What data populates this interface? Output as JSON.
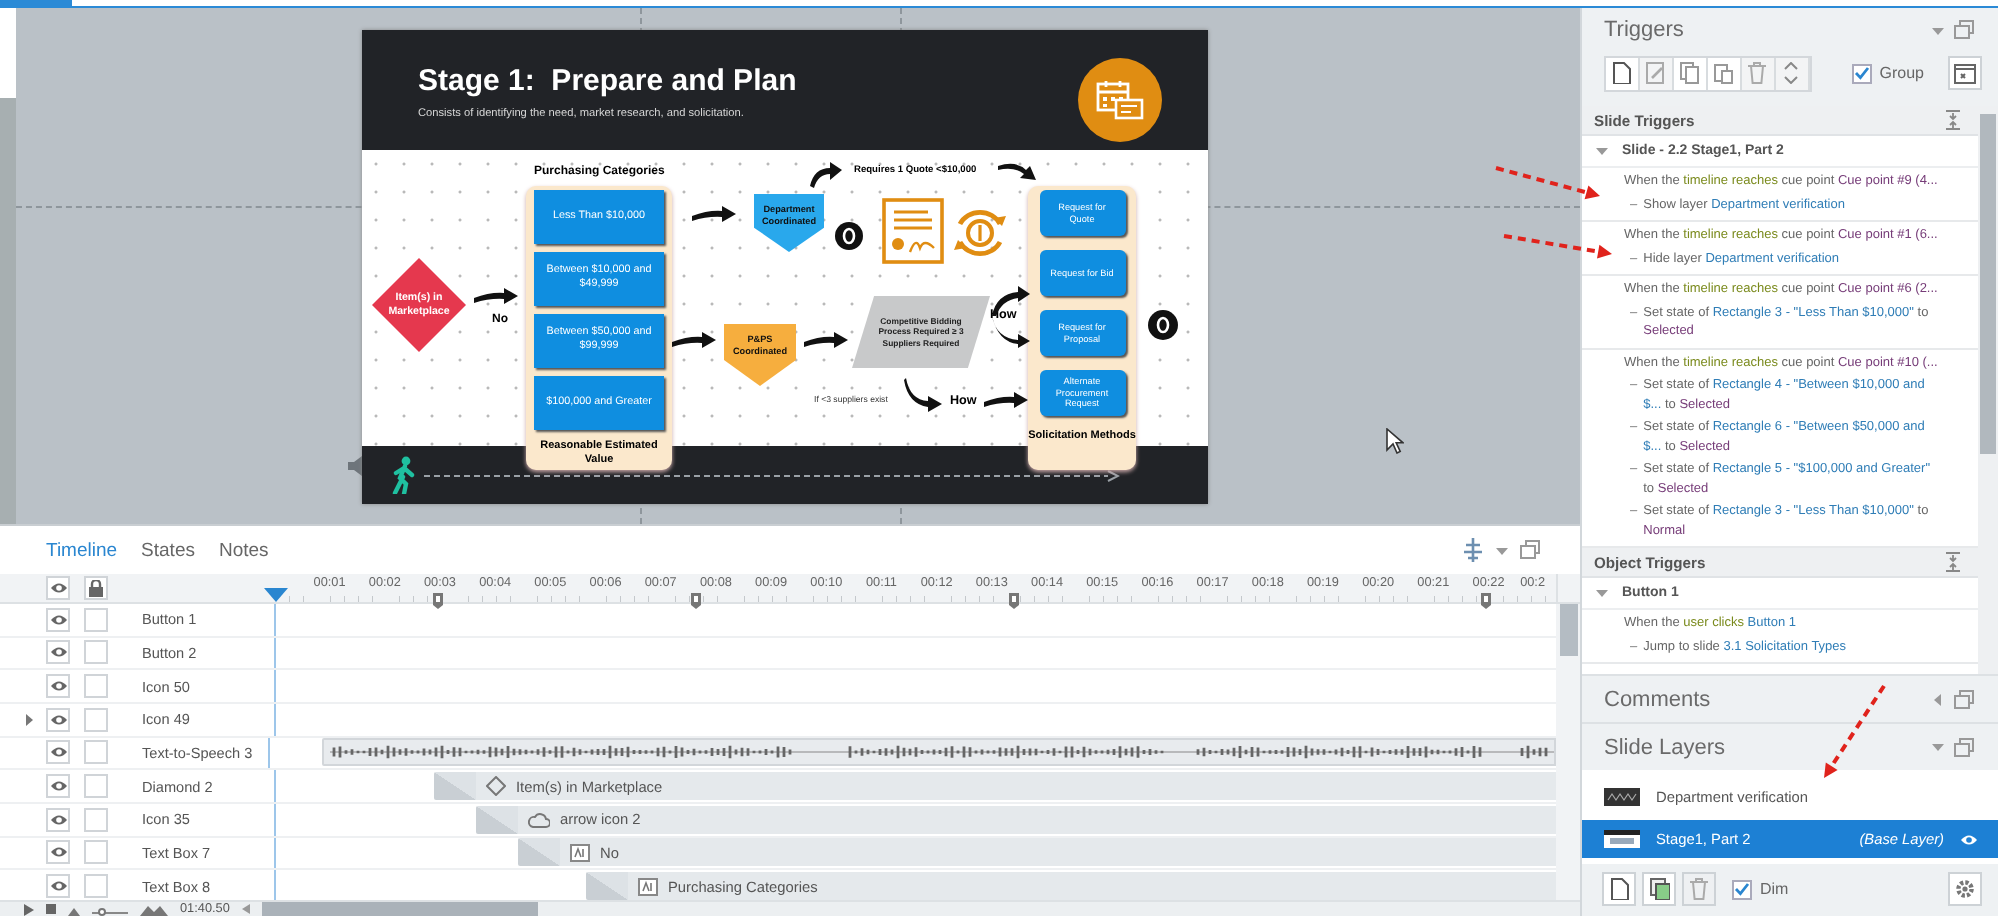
{
  "slide": {
    "title": "Stage 1:  Prepare and Plan",
    "subtitle": "Consists of identifying the need, market research, and solicitation.",
    "category_heading": "Purchasing Categories",
    "categories": [
      "Less Than $10,000",
      "Between $10,000 and $49,999",
      "Between $50,000 and $99,999",
      "$100,000 and Greater"
    ],
    "category_caption": "Reasonable Estimated Value",
    "methods": [
      "Request for Quote",
      "Request for Bid",
      "Request for Proposal",
      "Alternate Procurement Request"
    ],
    "methods_caption": "Solicitation Methods",
    "start": "Item(s) in Marketplace",
    "labels": [
      "No",
      "Requires 1 Quote <$10,000",
      "How",
      "If <3 suppliers exist",
      "How"
    ],
    "coordinators": [
      "Department Coordinated",
      "P&PS Coordinated"
    ],
    "bidding": "Competitive Bidding Process Required ≥ 3 Suppliers Required"
  },
  "timeline": {
    "tabs": [
      {
        "label": "Timeline",
        "selected": true
      },
      {
        "label": "States",
        "selected": false
      },
      {
        "label": "Notes",
        "selected": false
      }
    ],
    "ticks": [
      "00:01",
      "00:02",
      "00:03",
      "00:04",
      "00:05",
      "00:06",
      "00:07",
      "00:08",
      "00:09",
      "00:10",
      "00:11",
      "00:12",
      "00:13",
      "00:14",
      "00:15",
      "00:16",
      "00:17",
      "00:18",
      "00:19",
      "00:20",
      "00:21",
      "00:22",
      "00:2"
    ],
    "rows": [
      {
        "name": "Button 1",
        "expandable": false,
        "visible": true,
        "locked": false
      },
      {
        "name": "Button 2",
        "expandable": false,
        "visible": true,
        "locked": false
      },
      {
        "name": "Icon 50",
        "expandable": false,
        "visible": true,
        "locked": false
      },
      {
        "name": "Icon 49",
        "expandable": true,
        "visible": true,
        "locked": false
      },
      {
        "name": "Text-to-Speech 3",
        "expandable": false,
        "visible": true,
        "locked": false,
        "bar": {
          "kind": "audio"
        }
      },
      {
        "name": "Diamond 2",
        "expandable": false,
        "visible": true,
        "locked": false,
        "bar": {
          "kind": "shape",
          "label": "Item(s) in Marketplace"
        }
      },
      {
        "name": "Icon 35",
        "expandable": false,
        "visible": true,
        "locked": false,
        "bar": {
          "kind": "cloud",
          "label": "arrow icon 2"
        }
      },
      {
        "name": "Text Box 7",
        "expandable": false,
        "visible": true,
        "locked": false,
        "bar": {
          "kind": "text",
          "label": "No"
        }
      },
      {
        "name": "Text Box 8",
        "expandable": false,
        "visible": true,
        "locked": false,
        "bar": {
          "kind": "text",
          "label": "Purchasing Categories"
        }
      }
    ],
    "zoom": {
      "level": 0.2
    },
    "duration": "01:40.50"
  },
  "triggers": {
    "title": "Triggers",
    "group": {
      "label": "Group",
      "checked": true
    },
    "sections": [
      {
        "title": "Slide Triggers",
        "groups": [
          {
            "title": "Slide - 2.2 Stage1, Part 2",
            "expanded": true,
            "triggers": [
              {
                "when": [
                  {
                    "text": "When the",
                    "kind": "plain"
                  },
                  {
                    "text": "timeline reaches",
                    "kind": "event"
                  },
                  {
                    "text": "cue point",
                    "kind": "plain"
                  },
                  {
                    "text": "Cue point #9 (4...",
                    "kind": "value"
                  }
                ],
                "actions": [
                  {
                    "marker": "–",
                    "parts": [
                      {
                        "text": "Show layer",
                        "kind": "plain"
                      },
                      {
                        "text": "Department verification",
                        "kind": "object"
                      }
                    ]
                  }
                ]
              },
              {
                "when": [
                  {
                    "text": "When the",
                    "kind": "plain"
                  },
                  {
                    "text": "timeline reaches",
                    "kind": "event"
                  },
                  {
                    "text": "cue point",
                    "kind": "plain"
                  },
                  {
                    "text": "Cue point #1 (6...",
                    "kind": "value"
                  }
                ],
                "actions": [
                  {
                    "marker": "–",
                    "parts": [
                      {
                        "text": "Hide layer",
                        "kind": "plain"
                      },
                      {
                        "text": "Department verification",
                        "kind": "object"
                      }
                    ]
                  }
                ]
              },
              {
                "when": [
                  {
                    "text": "When the",
                    "kind": "plain"
                  },
                  {
                    "text": "timeline reaches",
                    "kind": "event"
                  },
                  {
                    "text": "cue point",
                    "kind": "plain"
                  },
                  {
                    "text": "Cue point #6 (2...",
                    "kind": "value"
                  }
                ],
                "actions": [
                  {
                    "marker": "–",
                    "parts": [
                      {
                        "text": "Set state of",
                        "kind": "plain"
                      },
                      {
                        "text": "Rectangle 3 - \"Less Than $10,000\"",
                        "kind": "object"
                      },
                      {
                        "text": "to",
                        "kind": "plain"
                      },
                      {
                        "text": "Selected",
                        "kind": "value"
                      }
                    ]
                  }
                ]
              },
              {
                "when": [
                  {
                    "text": "When the",
                    "kind": "plain"
                  },
                  {
                    "text": "timeline reaches",
                    "kind": "event"
                  },
                  {
                    "text": "cue point",
                    "kind": "plain"
                  },
                  {
                    "text": "Cue point #10 (...",
                    "kind": "value"
                  }
                ],
                "actions": [
                  {
                    "marker": "–",
                    "parts": [
                      {
                        "text": "Set state of",
                        "kind": "plain"
                      },
                      {
                        "text": "Rectangle 4 - \"Between $10,000 and $...",
                        "kind": "object"
                      },
                      {
                        "text": "to",
                        "kind": "plain"
                      },
                      {
                        "text": "Selected",
                        "kind": "value"
                      }
                    ]
                  },
                  {
                    "marker": "–",
                    "parts": [
                      {
                        "text": "Set state of",
                        "kind": "plain"
                      },
                      {
                        "text": "Rectangle 6 - \"Between $50,000 and $...",
                        "kind": "object"
                      },
                      {
                        "text": "to",
                        "kind": "plain"
                      },
                      {
                        "text": "Selected",
                        "kind": "value"
                      }
                    ]
                  },
                  {
                    "marker": "–",
                    "parts": [
                      {
                        "text": "Set state of",
                        "kind": "plain"
                      },
                      {
                        "text": "Rectangle 5 - \"$100,000 and Greater\"",
                        "kind": "object"
                      },
                      {
                        "text": "to",
                        "kind": "plain"
                      },
                      {
                        "text": "Selected",
                        "kind": "value"
                      }
                    ]
                  },
                  {
                    "marker": "–",
                    "parts": [
                      {
                        "text": "Set state of",
                        "kind": "plain"
                      },
                      {
                        "text": "Rectangle 3 - \"Less Than $10,000\"",
                        "kind": "object"
                      },
                      {
                        "text": "to",
                        "kind": "plain"
                      },
                      {
                        "text": "Normal",
                        "kind": "value"
                      }
                    ]
                  }
                ]
              }
            ]
          }
        ]
      },
      {
        "title": "Object Triggers",
        "groups": [
          {
            "title": "Button 1",
            "expanded": true,
            "triggers": [
              {
                "when": [
                  {
                    "text": "When the",
                    "kind": "plain"
                  },
                  {
                    "text": "user clicks",
                    "kind": "event"
                  },
                  {
                    "text": "Button 1",
                    "kind": "object"
                  }
                ],
                "actions": [
                  {
                    "marker": "–",
                    "parts": [
                      {
                        "text": "Jump to slide",
                        "kind": "plain"
                      },
                      {
                        "text": "3.1 Solicitation Types",
                        "kind": "object"
                      }
                    ]
                  }
                ]
              }
            ]
          }
        ]
      }
    ]
  },
  "comments": {
    "title": "Comments",
    "expanded": false
  },
  "layers": {
    "title": "Slide Layers",
    "expanded": true,
    "items": [
      {
        "name": "Department verification",
        "selected": false
      },
      {
        "name": "Stage1, Part 2",
        "note": "(Base Layer)",
        "selected": true
      }
    ],
    "dim": {
      "label": "Dim",
      "checked": true
    }
  }
}
